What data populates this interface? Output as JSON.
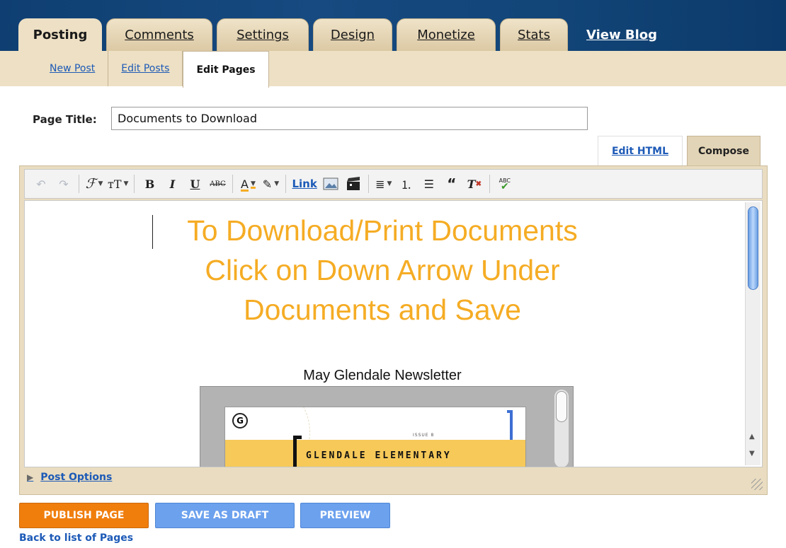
{
  "nav": {
    "tabs": [
      {
        "label": "Posting"
      },
      {
        "label": "Comments"
      },
      {
        "label": "Settings"
      },
      {
        "label": "Design"
      },
      {
        "label": "Monetize"
      },
      {
        "label": "Stats"
      }
    ],
    "view_blog": "View Blog"
  },
  "subnav": {
    "items": [
      {
        "label": "New Post"
      },
      {
        "label": "Edit Posts"
      },
      {
        "label": "Edit Pages"
      }
    ]
  },
  "page_title": {
    "label": "Page Title:",
    "value": "Documents to Download"
  },
  "modes": {
    "edit_html": "Edit HTML",
    "compose": "Compose"
  },
  "toolbar": {
    "link": "Link",
    "strike_label": "ABC",
    "spell_label": "ABC"
  },
  "content": {
    "headline_lines": [
      "To Download/Print Documents",
      "Click on Down Arrow Under",
      "Documents and Save"
    ],
    "newsletter_caption": "May Glendale Newsletter",
    "doc_title": "GLENDALE ELEMENTARY",
    "doc_issue": "ISSUE 8"
  },
  "post_options": "Post Options",
  "buttons": {
    "publish": "PUBLISH PAGE",
    "draft": "SAVE AS DRAFT",
    "preview": "PREVIEW"
  },
  "back_link": "Back to list of Pages",
  "colors": {
    "headline": "#f5ac24",
    "nav_bg": "#0f3f72",
    "tab_bg": "#ede0c4",
    "link": "#1d5ab7",
    "publish": "#f07e0d",
    "secondary": "#6ca1ee"
  }
}
